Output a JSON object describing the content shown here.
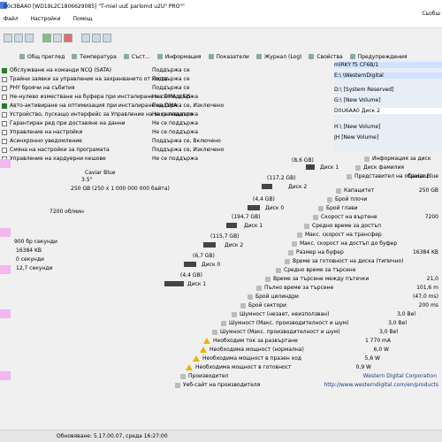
{
  "window": {
    "title": "00c3BAA0 [WD19L2C1806629085] \"T-miel uuE parlomd u2U\" PRO\"\"",
    "right_label": "Сьобш"
  },
  "menu": {
    "items": [
      "Файл",
      "Настройки",
      "Помощ"
    ]
  },
  "tabs": [
    "Общ преглед",
    "Температура",
    "Съст...",
    "Информация",
    "Показатели",
    "Журнал (Log)",
    "Свойства",
    "Предупреждения"
  ],
  "drives": [
    {
      "label": "mlRKY f5 CF6B/1",
      "color": "#cfe3ff"
    },
    {
      "label": "E:\\ \\WesternDigital",
      "color": "#cfe3ff"
    },
    {
      "label": "D:\\ [System Reserved]",
      "color": "#e8eef6"
    },
    {
      "label": "G:\\ [New Volume]",
      "color": "#e8eef6"
    },
    {
      "label": "D0U6AA0 Диск 2",
      "color": "#ffffff"
    },
    {
      "label": "H:\\ [New Volume]",
      "color": "#e8eef6"
    },
    {
      "label": "JH [New Volume]",
      "color": "#e8eef6"
    }
  ],
  "features": [
    {
      "label": "Обслужване на команди NCQ (SATA)",
      "checked": true,
      "status": "Поддържа се"
    },
    {
      "label": "Трайни заявки за управление на захранването от хоста",
      "checked": false,
      "status": "Поддържа се"
    },
    {
      "label": "PHY броячи на събития",
      "checked": false,
      "status": "Поддържа се"
    },
    {
      "label": "Не-нулево изместване на буфера при инсталиране на DMA в FIS",
      "checked": false,
      "status": "Не се поддържа"
    },
    {
      "label": "Авто-активиране на оптимизация при инсталиране на DMA",
      "checked": true,
      "status": "Поддържа се, Изключено"
    },
    {
      "label": "Устройство, пускащо интерфейс за Управление на захранването",
      "checked": false,
      "status": "Не се поддържа"
    },
    {
      "label": "Гарантиран ред при доставяне на данни",
      "checked": false,
      "status": "Не се поддържа"
    },
    {
      "label": "Управление на настройки",
      "checked": false,
      "status": "Не се поддържа"
    },
    {
      "label": "Асинхронно уведомление",
      "checked": false,
      "status": "Поддържа се, Включено"
    },
    {
      "label": "Смяна на настройки за програмата",
      "checked": false,
      "status": "Поддържа се, Изключено"
    },
    {
      "label": "Управление на хардуерни кешове",
      "checked": false,
      "status": "Не се поддържа"
    }
  ],
  "drive_sizes": [
    {
      "size": "(8,6 GB)",
      "part": "Диск 1"
    },
    {
      "size": "(117,2 GB)",
      "part": "Диск 2"
    },
    {
      "size": "(4,4 GB)",
      "part": "Диск 0"
    },
    {
      "size": "(194,7 GB)",
      "part": "Диск 1"
    },
    {
      "size": "(115,7 GB)",
      "part": "Диск 2"
    },
    {
      "size": "(6,7 GB)",
      "part": "Диск 0"
    },
    {
      "size": "(4,4 GB)",
      "part": "Диск 1"
    }
  ],
  "device": {
    "model": "Caviar Blue",
    "form": "3.5\"",
    "capacity": "250 GB (250 x 1 000 000 000 байта)",
    "rpm": "7200 об/мин",
    "cache": "16384 KB",
    "val_a": "0 секунди",
    "val_b": "12,7 секунди",
    "val_c": "900 бр секунди"
  },
  "attributes": [
    {
      "name": "Информация за диск",
      "value": ""
    },
    {
      "name": "Диск фамилия",
      "value": "Caviar Blue"
    },
    {
      "name": "Представител на обрацец",
      "value": ""
    },
    {
      "name": "Капацитет",
      "value": "250 GB"
    },
    {
      "name": "Брой плочи",
      "value": ""
    },
    {
      "name": "Брой глави",
      "value": ""
    },
    {
      "name": "Скорост на въртене",
      "value": "7200"
    },
    {
      "name": "Средно време за достъп",
      "value": ""
    },
    {
      "name": "Макс. скорост на трансфер",
      "value": ""
    },
    {
      "name": "Макс. скорост на достъп до буфер",
      "value": ""
    },
    {
      "name": "Размер на буфер",
      "value": "16384 KB"
    },
    {
      "name": "Време за готовност на диска (типично)",
      "value": ""
    },
    {
      "name": "Средно време за търсене",
      "value": ""
    },
    {
      "name": "Време за търсене между пътечки",
      "value": "21,0"
    },
    {
      "name": "Пълно време за търсене",
      "value": "101,6 m"
    },
    {
      "name": "Брой цилиндри",
      "value": "(47,0 ms)"
    },
    {
      "name": "Брой сектори",
      "value": "200 ms"
    },
    {
      "name": "Шумност (незает, неизползван)",
      "value": "3,0 Bel"
    },
    {
      "name": "Шумност (Макс. производителност и шум)",
      "value": "3,0 Bel"
    },
    {
      "name": "Шумност (Макс. производителност и шум)",
      "value": "3,0 Bel"
    },
    {
      "name": "Необходим ток за развъртане",
      "value": "1 770 mA"
    },
    {
      "name": "Необходима мощност (нормална)",
      "value": "6,0 W"
    },
    {
      "name": "Необходима мощност в празен ход",
      "value": "5,6 W"
    },
    {
      "name": "Необходима мощност в готовност",
      "value": "0,9 W"
    },
    {
      "name": "Производител",
      "value": "Western Digital Corporation"
    },
    {
      "name": "Уеб-сайт на производителя",
      "value": "http://www.westerndigital.com/en/products"
    }
  ],
  "status": {
    "text": "Обновяване: 5.17.00.07, среда 16:27:00"
  }
}
